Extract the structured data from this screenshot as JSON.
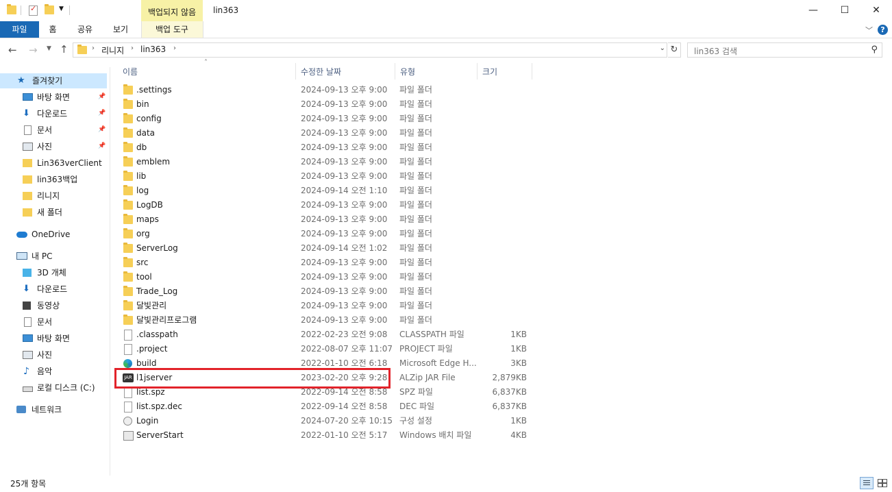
{
  "title_bar": {
    "contextual_tab_group": "백업되지 않음",
    "window_title": "lin363",
    "minimize": "—",
    "maximize": "☐",
    "close": "✕"
  },
  "ribbon": {
    "tabs": [
      "파일",
      "홈",
      "공유",
      "보기",
      "백업 도구"
    ],
    "help": "?"
  },
  "address": {
    "segments": [
      "리니지",
      "lin363"
    ],
    "search_placeholder": "lin363 검색"
  },
  "navigation": {
    "quick_access": "즐겨찾기",
    "quick_items": [
      {
        "label": "바탕 화면",
        "icon": "desktop-icon",
        "pinned": true
      },
      {
        "label": "다운로드",
        "icon": "download-icon",
        "pinned": true
      },
      {
        "label": "문서",
        "icon": "document-icon",
        "pinned": true
      },
      {
        "label": "사진",
        "icon": "pictures-icon",
        "pinned": true
      },
      {
        "label": "Lin363verClient",
        "icon": "folder-icon",
        "pinned": false
      },
      {
        "label": "lin363백업",
        "icon": "folder-icon",
        "pinned": false
      },
      {
        "label": "리니지",
        "icon": "folder-icon",
        "pinned": false
      },
      {
        "label": "새 폴더",
        "icon": "folder-icon",
        "pinned": false
      }
    ],
    "onedrive": "OneDrive",
    "this_pc": "내 PC",
    "pc_items": [
      {
        "label": "3D 개체",
        "icon": "3d-objects-icon"
      },
      {
        "label": "다운로드",
        "icon": "download-icon"
      },
      {
        "label": "동영상",
        "icon": "video-icon"
      },
      {
        "label": "문서",
        "icon": "document-icon"
      },
      {
        "label": "바탕 화면",
        "icon": "desktop-icon"
      },
      {
        "label": "사진",
        "icon": "pictures-icon"
      },
      {
        "label": "음악",
        "icon": "music-icon"
      },
      {
        "label": "로컬 디스크 (C:)",
        "icon": "drive-icon"
      }
    ],
    "network": "네트워크"
  },
  "columns": {
    "name": "이름",
    "date": "수정한 날짜",
    "type": "유형",
    "size": "크기"
  },
  "files": [
    {
      "name": ".settings",
      "date": "2024-09-13 오후 9:00",
      "type": "파일 폴더",
      "size": "",
      "icon": "folder"
    },
    {
      "name": "bin",
      "date": "2024-09-13 오후 9:00",
      "type": "파일 폴더",
      "size": "",
      "icon": "folder"
    },
    {
      "name": "config",
      "date": "2024-09-13 오후 9:00",
      "type": "파일 폴더",
      "size": "",
      "icon": "folder"
    },
    {
      "name": "data",
      "date": "2024-09-13 오후 9:00",
      "type": "파일 폴더",
      "size": "",
      "icon": "folder"
    },
    {
      "name": "db",
      "date": "2024-09-13 오후 9:00",
      "type": "파일 폴더",
      "size": "",
      "icon": "folder"
    },
    {
      "name": "emblem",
      "date": "2024-09-13 오후 9:00",
      "type": "파일 폴더",
      "size": "",
      "icon": "folder"
    },
    {
      "name": "lib",
      "date": "2024-09-13 오후 9:00",
      "type": "파일 폴더",
      "size": "",
      "icon": "folder"
    },
    {
      "name": "log",
      "date": "2024-09-14 오전 1:10",
      "type": "파일 폴더",
      "size": "",
      "icon": "folder"
    },
    {
      "name": "LogDB",
      "date": "2024-09-13 오후 9:00",
      "type": "파일 폴더",
      "size": "",
      "icon": "folder"
    },
    {
      "name": "maps",
      "date": "2024-09-13 오후 9:00",
      "type": "파일 폴더",
      "size": "",
      "icon": "folder"
    },
    {
      "name": "org",
      "date": "2024-09-13 오후 9:00",
      "type": "파일 폴더",
      "size": "",
      "icon": "folder"
    },
    {
      "name": "ServerLog",
      "date": "2024-09-14 오전 1:02",
      "type": "파일 폴더",
      "size": "",
      "icon": "folder"
    },
    {
      "name": "src",
      "date": "2024-09-13 오후 9:00",
      "type": "파일 폴더",
      "size": "",
      "icon": "folder"
    },
    {
      "name": "tool",
      "date": "2024-09-13 오후 9:00",
      "type": "파일 폴더",
      "size": "",
      "icon": "folder"
    },
    {
      "name": "Trade_Log",
      "date": "2024-09-13 오후 9:00",
      "type": "파일 폴더",
      "size": "",
      "icon": "folder"
    },
    {
      "name": "달빛관리",
      "date": "2024-09-13 오후 9:00",
      "type": "파일 폴더",
      "size": "",
      "icon": "folder"
    },
    {
      "name": "달빛관리프로그램",
      "date": "2024-09-13 오후 9:00",
      "type": "파일 폴더",
      "size": "",
      "icon": "folder"
    },
    {
      "name": ".classpath",
      "date": "2022-02-23 오전 9:08",
      "type": "CLASSPATH 파일",
      "size": "1KB",
      "icon": "file"
    },
    {
      "name": ".project",
      "date": "2022-08-07 오후 11:07",
      "type": "PROJECT 파일",
      "size": "1KB",
      "icon": "file"
    },
    {
      "name": "build",
      "date": "2022-01-10 오전 6:18",
      "type": "Microsoft Edge H...",
      "size": "3KB",
      "icon": "edge"
    },
    {
      "name": "l1jserver",
      "date": "2023-02-20 오후 9:28",
      "type": "ALZip JAR File",
      "size": "2,879KB",
      "icon": "jar"
    },
    {
      "name": "list.spz",
      "date": "2022-09-14 오전 8:58",
      "type": "SPZ 파일",
      "size": "6,837KB",
      "icon": "file"
    },
    {
      "name": "list.spz.dec",
      "date": "2022-09-14 오전 8:58",
      "type": "DEC 파일",
      "size": "6,837KB",
      "icon": "file"
    },
    {
      "name": "Login",
      "date": "2024-07-20 오후 10:15",
      "type": "구성 설정",
      "size": "1KB",
      "icon": "config"
    },
    {
      "name": "ServerStart",
      "date": "2022-01-10 오전 5:17",
      "type": "Windows 배치 파일",
      "size": "4KB",
      "icon": "batch"
    }
  ],
  "jar_icon_text": "JAR",
  "status": {
    "item_count": "25개 항목"
  },
  "colors": {
    "accent": "#1a69b5",
    "highlight": "#e2232a",
    "context_tab": "#f7f1a6",
    "folder": "#f6cf57"
  }
}
